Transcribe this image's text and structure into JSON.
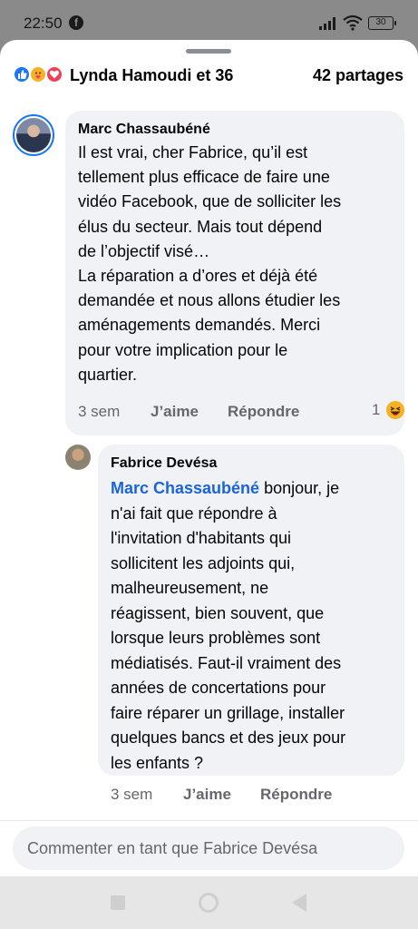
{
  "status_bar": {
    "time": "22:50",
    "battery": "30"
  },
  "post_summary": {
    "reactors": "Lynda Hamoudi et 36",
    "shares": "42 partages",
    "reaction_icons": [
      "like-icon",
      "care-icon",
      "love-icon"
    ]
  },
  "comments": [
    {
      "author": "Marc Chassaubéné",
      "text_lines": [
        "Il est vrai, cher Fabrice, qu’il est",
        "tellement plus efficace de faire une",
        "vidéo Facebook, que de solliciter les",
        "élus du secteur. Mais tout dépend",
        "de l’objectif visé…",
        "La réparation a d’ores et déjà été",
        "demandée et nous allons étudier les",
        "aménagements demandés. Merci",
        "pour votre implication pour le",
        "quartier."
      ],
      "time": "3 sem",
      "like_label": "J’aime",
      "reply_label": "Répondre",
      "reaction_count": "1",
      "reaction_icon": "haha-icon"
    },
    {
      "author": "Fabrice Devésa",
      "mention": "Marc Chassaubéné",
      "text_first_line_rest": " bonjour, je",
      "text_lines": [
        "n'ai fait que répondre à",
        "l'invitation d'habitants qui",
        "sollicitent les adjoints qui,",
        "malheureusement, ne",
        "réagissent, bien souvent, que",
        "lorsque leurs problèmes sont",
        "médiatisés. Faut-il vraiment des",
        "années de concertations pour",
        "faire réparer un grillage, installer",
        "quelques bancs et des jeux pour",
        "les enfants ?"
      ],
      "time": "3 sem",
      "like_label": "J’aime",
      "reply_label": "Répondre"
    }
  ],
  "composer": {
    "placeholder": "Commenter en tant que Fabrice Devésa"
  },
  "colors": {
    "accent": "#1877f2",
    "mention": "#1b64d8",
    "bubble": "#f0f2f5",
    "secondary_text": "#65676b"
  }
}
